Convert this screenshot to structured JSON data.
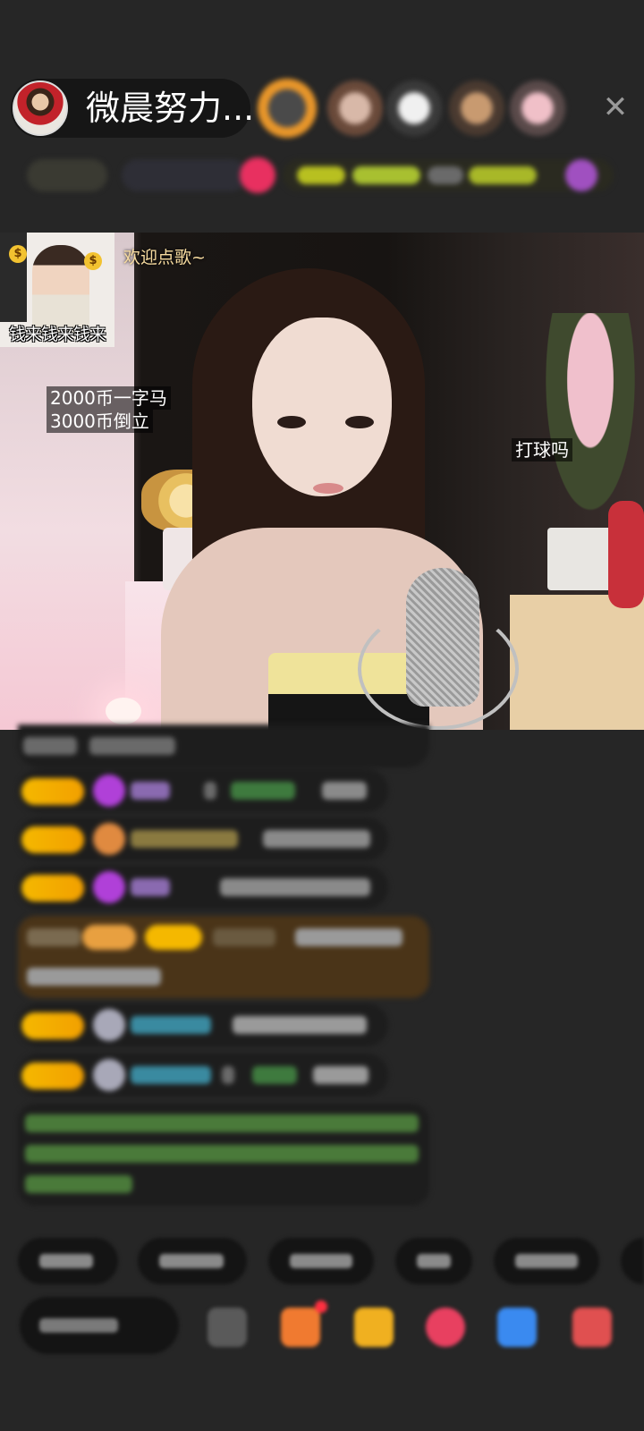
{
  "header": {
    "host_name": "微晨努力...",
    "close_symbol": "✕"
  },
  "video": {
    "sticker_caption": "钱来钱来钱来",
    "welcome_text": "欢迎点歌~",
    "price_line_1": "2000币一字马",
    "price_line_2": "3000币倒立",
    "side_text": "打球吗",
    "coin_symbol": "$"
  },
  "colors": {
    "background": "#262626",
    "badge": "#f5b800",
    "chat_bubble": "#1d1d1d",
    "highlight_bubble": "#4a3418"
  }
}
